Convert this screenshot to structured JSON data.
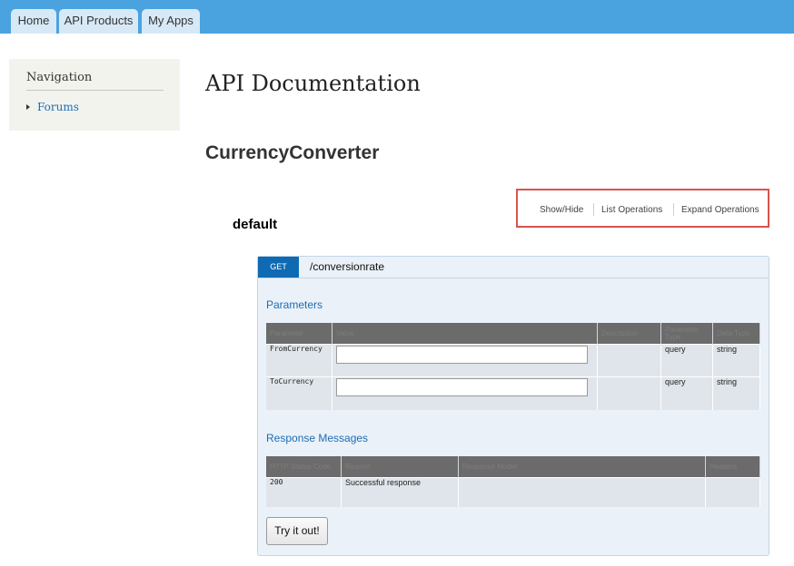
{
  "tabs": [
    {
      "label": "Home"
    },
    {
      "label": "API Products"
    },
    {
      "label": "My Apps"
    }
  ],
  "nav": {
    "title": "Navigation",
    "items": [
      {
        "label": "Forums"
      }
    ]
  },
  "page": {
    "title": "API Documentation",
    "api_name": "CurrencyConverter",
    "resource_name": "default"
  },
  "operations": {
    "show_hide": "Show/Hide",
    "list_operations": "List Operations",
    "expand_operations": "Expand Operations"
  },
  "endpoint": {
    "method": "GET",
    "path": "/conversionrate"
  },
  "parameters": {
    "heading": "Parameters",
    "columns": [
      "Parameter",
      "Value",
      "Description",
      "Parameter Type",
      "Data Type"
    ],
    "rows": [
      {
        "name": "FromCurrency",
        "value": "",
        "description": "",
        "param_type": "query",
        "data_type": "string"
      },
      {
        "name": "ToCurrency",
        "value": "",
        "description": "",
        "param_type": "query",
        "data_type": "string"
      }
    ]
  },
  "responses": {
    "heading": "Response Messages",
    "columns": [
      "HTTP Status Code",
      "Reason",
      "Response Model",
      "Headers"
    ],
    "rows": [
      {
        "code": "200",
        "reason": "Successful response",
        "model": "",
        "headers": ""
      }
    ]
  },
  "actions": {
    "try_label": "Try it out!"
  },
  "colors": {
    "topbar": "#4aa3df",
    "method_badge": "#0f6ab4",
    "highlight_border": "#d9534f"
  }
}
